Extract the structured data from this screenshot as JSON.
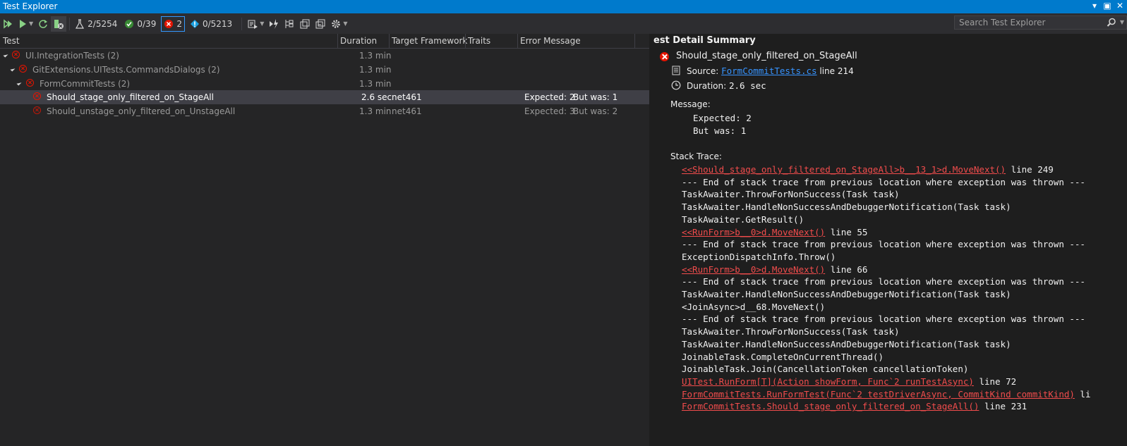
{
  "window": {
    "title": "Test Explorer"
  },
  "toolbar": {
    "total_tests": "2/5254",
    "passed": "0/39",
    "failed": "2",
    "not_run": "0/5213"
  },
  "search": {
    "placeholder": "Search Test Explorer"
  },
  "grid": {
    "columns": [
      "Test",
      "Duration",
      "Target Framework",
      "Traits",
      "Error Message"
    ],
    "rows": [
      {
        "name": "UI.IntegrationTests  (2)",
        "duration": "1.3 min",
        "framework": "",
        "error_expected": "",
        "error_butwas": ""
      },
      {
        "name": "GitExtensions.UITests.CommandsDialogs  (2)",
        "duration": "1.3 min",
        "framework": "",
        "error_expected": "",
        "error_butwas": ""
      },
      {
        "name": "FormCommitTests  (2)",
        "duration": "1.3 min",
        "framework": "",
        "error_expected": "",
        "error_butwas": ""
      },
      {
        "name": "Should_stage_only_filtered_on_StageAll",
        "duration": "2.6 sec",
        "framework": "net461",
        "error_expected": "Expected: 2",
        "error_butwas": "But was:  1"
      },
      {
        "name": "Should_unstage_only_filtered_on_UnstageAll",
        "duration": "1.3 min",
        "framework": "net461",
        "error_expected": "Expected: 3",
        "error_butwas": "But was:  2"
      }
    ]
  },
  "detail": {
    "title": "est Detail Summary",
    "test_name": "Should_stage_only_filtered_on_StageAll",
    "source_label": "Source:",
    "source_file": "FormCommitTests.cs",
    "source_line": "line 214",
    "duration_label": "Duration:",
    "duration_value": "2.6 sec",
    "message_label": "Message:",
    "message_lines": [
      "Expected: 2",
      "But was:  1"
    ],
    "stack_label": "Stack Trace:",
    "stack": [
      {
        "link": "<<Should_stage_only_filtered_on_StageAll>b__13_1>d.MoveNext()",
        "text": " line 249"
      },
      {
        "link": "",
        "text": "--- End of stack trace from previous location where exception was thrown ---"
      },
      {
        "link": "",
        "text": "TaskAwaiter.ThrowForNonSuccess(Task task)"
      },
      {
        "link": "",
        "text": "TaskAwaiter.HandleNonSuccessAndDebuggerNotification(Task task)"
      },
      {
        "link": "",
        "text": "TaskAwaiter.GetResult()"
      },
      {
        "link": "<<RunForm>b__0>d.MoveNext()",
        "text": " line 55"
      },
      {
        "link": "",
        "text": "--- End of stack trace from previous location where exception was thrown ---"
      },
      {
        "link": "",
        "text": "ExceptionDispatchInfo.Throw()"
      },
      {
        "link": "<<RunForm>b__0>d.MoveNext()",
        "text": " line 66"
      },
      {
        "link": "",
        "text": "--- End of stack trace from previous location where exception was thrown ---"
      },
      {
        "link": "",
        "text": "TaskAwaiter.HandleNonSuccessAndDebuggerNotification(Task task)"
      },
      {
        "link": "",
        "text": "<JoinAsync>d__68.MoveNext()"
      },
      {
        "link": "",
        "text": "--- End of stack trace from previous location where exception was thrown ---"
      },
      {
        "link": "",
        "text": "TaskAwaiter.ThrowForNonSuccess(Task task)"
      },
      {
        "link": "",
        "text": "TaskAwaiter.HandleNonSuccessAndDebuggerNotification(Task task)"
      },
      {
        "link": "",
        "text": "JoinableTask.CompleteOnCurrentThread()"
      },
      {
        "link": "",
        "text": "JoinableTask.Join(CancellationToken cancellationToken)"
      },
      {
        "link": "UITest.RunForm[T](Action showForm, Func`2 runTestAsync)",
        "text": " line 72"
      },
      {
        "link": "FormCommitTests.RunFormTest(Func`2 testDriverAsync, CommitKind commitKind)",
        "text": " li"
      },
      {
        "link": "FormCommitTests.Should_stage_only_filtered_on_StageAll()",
        "text": " line 231"
      }
    ]
  },
  "colors": {
    "accent": "#007acc",
    "fail": "#e51400",
    "link": "#3794ff",
    "stack_link": "#f14c4c"
  }
}
